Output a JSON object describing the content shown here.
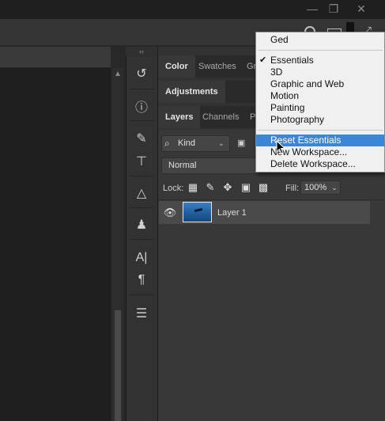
{
  "window": {
    "minimize_icon": "minimize-icon",
    "restore_icon": "restore-icon",
    "close_icon": "close-icon"
  },
  "collapse_glyph": "‹‹",
  "panel_tabs_top": [
    "Color",
    "Swatches",
    "Gr"
  ],
  "adjustments_tab": "Adjustments",
  "layers_tabs": [
    "Layers",
    "Channels",
    "P"
  ],
  "layers": {
    "filter_kind": "Kind",
    "blend_mode": "Normal",
    "lock_label": "Lock:",
    "fill_label": "Fill:",
    "fill_value": "100%",
    "items": [
      {
        "name": "Layer 1",
        "visible": true
      }
    ]
  },
  "workspace_menu": {
    "items": [
      {
        "label": "Ged",
        "checked": false
      },
      {
        "label": "Essentials",
        "checked": true
      },
      {
        "label": "3D",
        "checked": false
      },
      {
        "label": "Graphic and Web",
        "checked": false
      },
      {
        "label": "Motion",
        "checked": false
      },
      {
        "label": "Painting",
        "checked": false
      },
      {
        "label": "Photography",
        "checked": false
      }
    ],
    "actions": [
      {
        "label": "Reset Essentials",
        "highlighted": true
      },
      {
        "label": "New Workspace..."
      },
      {
        "label": "Delete Workspace..."
      }
    ]
  },
  "colors": {
    "menu_highlight": "#3b86d6",
    "panel_bg": "#383838",
    "selected_layer": "#4a4a4a"
  }
}
